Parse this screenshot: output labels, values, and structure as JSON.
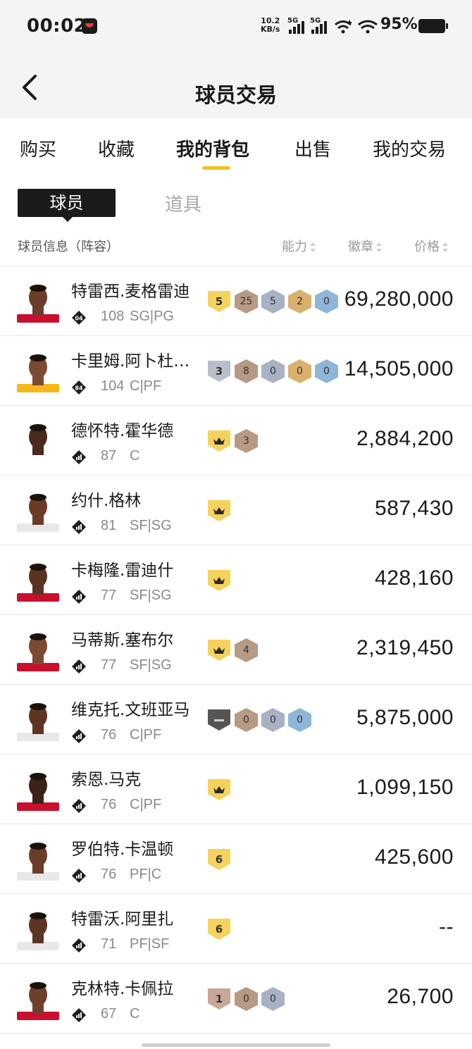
{
  "status_bar": {
    "time": "00:02",
    "net_speed_value": "10.2",
    "net_speed_unit": "KB/s",
    "sim1": "5G",
    "sim2": "5G",
    "battery": "95%"
  },
  "header": {
    "title": "球员交易"
  },
  "tabs": [
    {
      "label": "购买"
    },
    {
      "label": "收藏"
    },
    {
      "label": "我的背包"
    },
    {
      "label": "出售"
    },
    {
      "label": "我的交易"
    }
  ],
  "active_tab": "我的背包",
  "subtabs": {
    "player": "球员",
    "items": "道具"
  },
  "columns": {
    "info": "球员信息（阵容）",
    "ability": "能力",
    "badge": "徽章",
    "price": "价格"
  },
  "colors": {
    "accent": "#f2c318",
    "badge_bronze": "#b79a84",
    "badge_silver": "#a9b2c2",
    "badge_gold": "#d9b06c",
    "badge_blue": "#8fb6d9"
  },
  "players": [
    {
      "name": "特雷西.麦格雷迪",
      "tier": "04",
      "rating": "108",
      "position": "SG|PG",
      "price": "69,280,000",
      "badges": [
        {
          "kind": "shield",
          "text": "5",
          "color": "#f5d25c"
        },
        {
          "kind": "hex",
          "text": "25",
          "cls": "c1"
        },
        {
          "kind": "hex",
          "text": "5",
          "cls": "c2"
        },
        {
          "kind": "hex",
          "text": "2",
          "cls": "c3"
        },
        {
          "kind": "hex",
          "text": "0",
          "cls": "c4"
        }
      ]
    },
    {
      "name": "卡里姆.阿卜杜…",
      "tier": "84",
      "rating": "104",
      "position": "C|PF",
      "price": "14,505,000",
      "badges": [
        {
          "kind": "shield",
          "text": "3",
          "color": "#b9bfca"
        },
        {
          "kind": "hex",
          "text": "8",
          "cls": "c1"
        },
        {
          "kind": "hex",
          "text": "0",
          "cls": "c2"
        },
        {
          "kind": "hex",
          "text": "0",
          "cls": "c3"
        },
        {
          "kind": "hex",
          "text": "0",
          "cls": "c4"
        }
      ]
    },
    {
      "name": "德怀特.霍华德",
      "tier": "",
      "rating": "87",
      "position": "C",
      "price": "2,884,200",
      "badges": [
        {
          "kind": "crown",
          "color": "#f5d25c"
        },
        {
          "kind": "hex",
          "text": "3",
          "cls": "c1"
        }
      ]
    },
    {
      "name": "约什.格林",
      "tier": "",
      "rating": "81",
      "position": "SF|SG",
      "price": "587,430",
      "badges": [
        {
          "kind": "crown",
          "color": "#f5d25c"
        }
      ]
    },
    {
      "name": "卡梅隆.雷迪什",
      "tier": "",
      "rating": "77",
      "position": "SF|SG",
      "price": "428,160",
      "badges": [
        {
          "kind": "crown",
          "color": "#f5d25c"
        }
      ]
    },
    {
      "name": "马蒂斯.塞布尔",
      "tier": "",
      "rating": "77",
      "position": "SF|SG",
      "price": "2,319,450",
      "badges": [
        {
          "kind": "crown",
          "color": "#f5d25c"
        },
        {
          "kind": "hex",
          "text": "4",
          "cls": "c1"
        }
      ]
    },
    {
      "name": "维克托.文班亚马",
      "tier": "",
      "rating": "76",
      "position": "C|PF",
      "price": "5,875,000",
      "badges": [
        {
          "kind": "dash",
          "color": "#555555"
        },
        {
          "kind": "hex",
          "text": "0",
          "cls": "c1"
        },
        {
          "kind": "hex",
          "text": "0",
          "cls": "c2"
        },
        {
          "kind": "hex",
          "text": "0",
          "cls": "c4"
        }
      ]
    },
    {
      "name": "索恩.马克",
      "tier": "",
      "rating": "76",
      "position": "C|PF",
      "price": "1,099,150",
      "badges": [
        {
          "kind": "crown",
          "color": "#f5d25c"
        }
      ]
    },
    {
      "name": "罗伯特.卡温顿",
      "tier": "",
      "rating": "76",
      "position": "PF|C",
      "price": "425,600",
      "badges": [
        {
          "kind": "shield",
          "text": "6",
          "color": "#f5d25c"
        }
      ]
    },
    {
      "name": "特雷沃.阿里扎",
      "tier": "",
      "rating": "71",
      "position": "PF|SF",
      "price": "--",
      "badges": [
        {
          "kind": "shield",
          "text": "6",
          "color": "#f5d25c"
        }
      ]
    },
    {
      "name": "克林特.卡佩拉",
      "tier": "",
      "rating": "67",
      "position": "C",
      "price": "26,700",
      "badges": [
        {
          "kind": "shield",
          "text": "1",
          "color": "#c9a795"
        },
        {
          "kind": "hex",
          "text": "0",
          "cls": "c1"
        },
        {
          "kind": "hex",
          "text": "0",
          "cls": "c2"
        }
      ]
    }
  ]
}
